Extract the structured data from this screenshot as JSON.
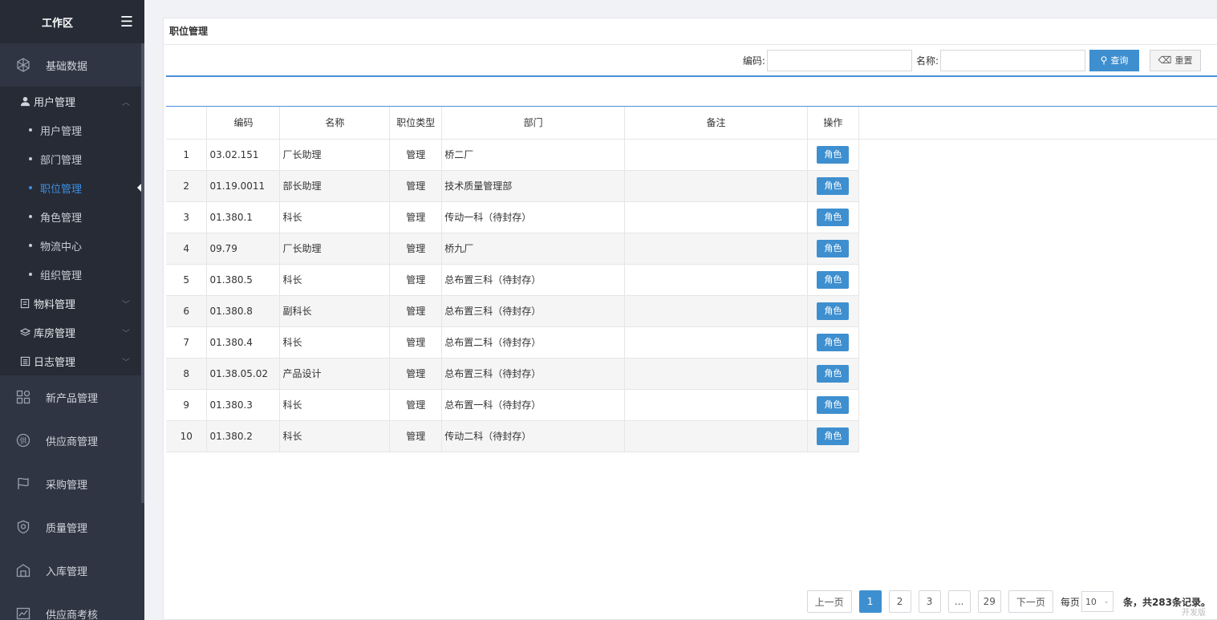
{
  "sidebar": {
    "title": "工作区",
    "top_items_before": [
      {
        "label": "基础数据",
        "icon": "cube-icon"
      }
    ],
    "groups": [
      {
        "label": "用户管理",
        "icon": "user-icon",
        "expanded": true,
        "items": [
          {
            "label": "用户管理",
            "active": false
          },
          {
            "label": "部门管理",
            "active": false
          },
          {
            "label": "职位管理",
            "active": true
          },
          {
            "label": "角色管理",
            "active": false
          },
          {
            "label": "物流中心",
            "active": false
          },
          {
            "label": "组织管理",
            "active": false
          }
        ]
      },
      {
        "label": "物料管理",
        "icon": "material-icon",
        "expanded": false,
        "items": []
      },
      {
        "label": "库房管理",
        "icon": "layers-icon",
        "expanded": false,
        "items": []
      },
      {
        "label": "日志管理",
        "icon": "log-icon",
        "expanded": false,
        "items": []
      }
    ],
    "top_items_after": [
      {
        "label": "新产品管理",
        "icon": "grid-icon"
      },
      {
        "label": "供应商管理",
        "icon": "supplier-icon"
      },
      {
        "label": "采购管理",
        "icon": "flag-icon"
      },
      {
        "label": "质量管理",
        "icon": "shield-icon"
      },
      {
        "label": "入库管理",
        "icon": "warehouse-icon"
      },
      {
        "label": "供应商考核",
        "icon": "chart-icon"
      }
    ]
  },
  "panel": {
    "title": "职位管理"
  },
  "search": {
    "code_label": "编码:",
    "code_value": "",
    "name_label": "名称:",
    "name_value": "",
    "query_label": "查询",
    "reset_label": "重置"
  },
  "table": {
    "columns": [
      "",
      "编码",
      "名称",
      "职位类型",
      "部门",
      "备注",
      "操作"
    ],
    "action_label": "角色",
    "rows": [
      {
        "no": "1",
        "code": "03.02.151",
        "name": "厂长助理",
        "type": "管理",
        "dept": "桥二厂",
        "remark": ""
      },
      {
        "no": "2",
        "code": "01.19.0011",
        "name": "部长助理",
        "type": "管理",
        "dept": "技术质量管理部",
        "remark": ""
      },
      {
        "no": "3",
        "code": "01.380.1",
        "name": "科长",
        "type": "管理",
        "dept": "传动一科（待封存）",
        "remark": ""
      },
      {
        "no": "4",
        "code": "09.79",
        "name": "厂长助理",
        "type": "管理",
        "dept": "桥九厂",
        "remark": ""
      },
      {
        "no": "5",
        "code": "01.380.5",
        "name": "科长",
        "type": "管理",
        "dept": "总布置三科（待封存）",
        "remark": ""
      },
      {
        "no": "6",
        "code": "01.380.8",
        "name": "副科长",
        "type": "管理",
        "dept": "总布置三科（待封存）",
        "remark": ""
      },
      {
        "no": "7",
        "code": "01.380.4",
        "name": "科长",
        "type": "管理",
        "dept": "总布置二科（待封存）",
        "remark": ""
      },
      {
        "no": "8",
        "code": "01.38.05.02",
        "name": "产品设计",
        "type": "管理",
        "dept": "总布置三科（待封存）",
        "remark": ""
      },
      {
        "no": "9",
        "code": "01.380.3",
        "name": "科长",
        "type": "管理",
        "dept": "总布置一科（待封存）",
        "remark": ""
      },
      {
        "no": "10",
        "code": "01.380.2",
        "name": "科长",
        "type": "管理",
        "dept": "传动二科（待封存）",
        "remark": ""
      }
    ]
  },
  "pager": {
    "prev_label": "上一页",
    "pages": [
      "1",
      "2",
      "3",
      "...",
      "29"
    ],
    "current": "1",
    "next_label": "下一页",
    "per_page_label": "每页",
    "per_page_value": "10",
    "total_text": "条，共283条记录。",
    "dev_mark": "开发版"
  },
  "colors": {
    "sidebar_bg": "#2f3542",
    "accent": "#3e8fcf",
    "active_nav": "#3e8fe0"
  }
}
